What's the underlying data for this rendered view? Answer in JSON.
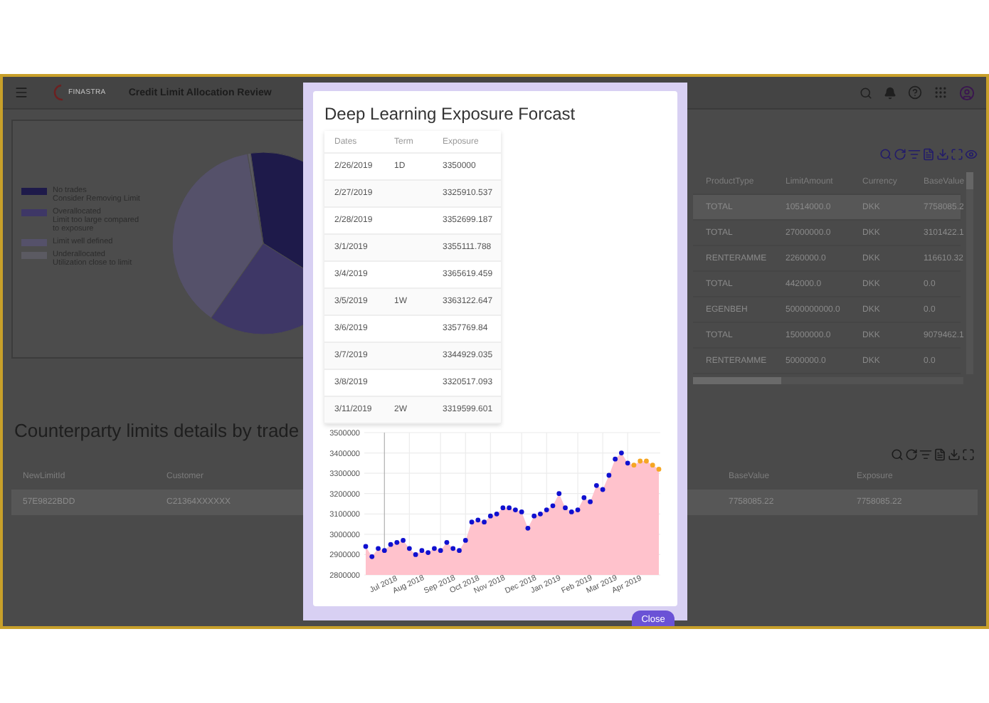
{
  "app_bar": {
    "logo_text": "FINASTRA",
    "title": "Credit Limit Allocation Review"
  },
  "allocation_chart": {
    "legend": [
      {
        "lines": [
          "No trades",
          "Consider Removing Limit"
        ],
        "color": "#1e1a4a"
      },
      {
        "lines": [
          "Overallocated",
          "Limit too large compared",
          "to exposure"
        ],
        "color": "#3e3766"
      },
      {
        "lines": [
          "Limit well defined"
        ],
        "color": "#55516a"
      },
      {
        "lines": [
          "Underallocated",
          "Utilization close to limit"
        ],
        "color": "#5b5a62"
      }
    ]
  },
  "limits_table": {
    "columns": [
      "ProductType",
      "LimitAmount",
      "Currency",
      "BaseValue"
    ],
    "rows": [
      {
        "cells": [
          "TOTAL",
          "10514000.0",
          "DKK",
          "7758085.2"
        ],
        "selected": true
      },
      {
        "cells": [
          "TOTAL",
          "27000000.0",
          "DKK",
          "3101422.1"
        ],
        "selected": false
      },
      {
        "cells": [
          "RENTERAMME",
          "2260000.0",
          "DKK",
          "116610.32"
        ],
        "selected": false
      },
      {
        "cells": [
          "TOTAL",
          "442000.0",
          "DKK",
          "0.0"
        ],
        "selected": false
      },
      {
        "cells": [
          "EGENBEH",
          "5000000000.0",
          "DKK",
          "0.0"
        ],
        "selected": false
      },
      {
        "cells": [
          "TOTAL",
          "15000000.0",
          "DKK",
          "9079462.1"
        ],
        "selected": false
      },
      {
        "cells": [
          "RENTERAMME",
          "5000000.0",
          "DKK",
          "0.0"
        ],
        "selected": false
      }
    ]
  },
  "trade_section": {
    "title": "Counterparty limits details by trade",
    "columns": [
      "NewLimitId",
      "Customer",
      "BaseValue",
      "Exposure"
    ],
    "rows": [
      {
        "cells": [
          "57E9822BDD",
          "C21364XXXXXX",
          "7758085.22",
          "7758085.22"
        ],
        "selected": true
      }
    ]
  },
  "dialog": {
    "title": "Deep Learning Exposure Forcast",
    "table": {
      "columns": [
        "Dates",
        "Term",
        "Exposure"
      ],
      "rows": [
        {
          "date": "2/26/2019",
          "term": "1D",
          "exposure": "3350000"
        },
        {
          "date": "2/27/2019",
          "exposure": "3325910.537"
        },
        {
          "date": "2/28/2019",
          "exposure": "3352699.187"
        },
        {
          "date": "3/1/2019",
          "exposure": "3355111.788"
        },
        {
          "date": "3/4/2019",
          "exposure": "3365619.459"
        },
        {
          "date": "3/5/2019",
          "term": "1W",
          "exposure": "3363122.647"
        },
        {
          "date": "3/6/2019",
          "exposure": "3357769.84"
        },
        {
          "date": "3/7/2019",
          "exposure": "3344929.035"
        },
        {
          "date": "3/8/2019",
          "exposure": "3320517.093"
        },
        {
          "date": "3/11/2019",
          "term": "2W",
          "exposure": "3319599.601"
        }
      ]
    },
    "markers": [
      {
        "color": "#1010d0"
      },
      {
        "color": "#1010d0"
      },
      {
        "color": "#1010d0"
      },
      {
        "color": "#1010d0"
      },
      {
        "color": "#1010d0"
      },
      {
        "color": "#1010d0"
      },
      {
        "color": "#1010d0"
      },
      {
        "color": "#1010d0"
      },
      {
        "color": "#1010d0"
      },
      {
        "color": "#1010d0"
      },
      {
        "color": "#1010d0"
      },
      {
        "color": "#1010d0"
      },
      {
        "color": "#1010d0"
      },
      {
        "color": "#1010d0"
      },
      {
        "color": "#1010d0"
      },
      {
        "color": "#1010d0"
      },
      {
        "color": "#1010d0"
      },
      {
        "color": "#1010d0"
      },
      {
        "color": "#1010d0"
      },
      {
        "color": "#1010d0"
      },
      {
        "color": "#1010d0"
      },
      {
        "color": "#1010d0"
      },
      {
        "color": "#1010d0"
      },
      {
        "color": "#1010d0"
      },
      {
        "color": "#1010d0"
      },
      {
        "color": "#1010d0"
      },
      {
        "color": "#1010d0"
      },
      {
        "color": "#1010d0"
      },
      {
        "color": "#1010d0"
      },
      {
        "color": "#1010d0"
      },
      {
        "color": "#1010d0"
      },
      {
        "color": "#1010d0"
      },
      {
        "color": "#1010d0"
      },
      {
        "color": "#1010d0"
      },
      {
        "color": "#1010d0"
      },
      {
        "color": "#1010d0"
      },
      {
        "color": "#1010d0"
      },
      {
        "color": "#1010d0"
      },
      {
        "color": "#1010d0"
      },
      {
        "color": "#1010d0"
      },
      {
        "color": "#1010d0"
      },
      {
        "color": "#1010d0"
      },
      {
        "color": "#1010d0"
      },
      {
        "color": "#f5a623"
      },
      {
        "color": "#f5a623"
      },
      {
        "color": "#f5a623"
      },
      {
        "color": "#f5a623"
      },
      {
        "color": "#f5a623"
      }
    ],
    "chart_data": {
      "type": "area",
      "grid": true,
      "categories": [
        null,
        null,
        null,
        "Jul 2018",
        null,
        null,
        null,
        "Aug 2018",
        null,
        null,
        null,
        null,
        "Sep 2018",
        null,
        null,
        null,
        "Oct 2018",
        null,
        null,
        null,
        "Nov 2018",
        null,
        null,
        null,
        null,
        "Dec 2018",
        null,
        null,
        null,
        "Jan 2019",
        null,
        null,
        null,
        null,
        "Feb 2019",
        null,
        null,
        null,
        "Mar 2019",
        null,
        null,
        null,
        "Apr 2019",
        null,
        null,
        null,
        null,
        null
      ],
      "series": [
        {
          "color": "#ffc2cc",
          "values": [
            2940000,
            2890000,
            2930000,
            2920000,
            2950000,
            2960000,
            2970000,
            2930000,
            2900000,
            2920000,
            2910000,
            2930000,
            2920000,
            2960000,
            2930000,
            2920000,
            2970000,
            3060000,
            3070000,
            3060000,
            3090000,
            3100000,
            3130000,
            3130000,
            3120000,
            3110000,
            3030000,
            3090000,
            3100000,
            3120000,
            3140000,
            3200000,
            3130000,
            3110000,
            3120000,
            3180000,
            3160000,
            3240000,
            3220000,
            3290000,
            3370000,
            3400000,
            3350000,
            3340000,
            3360000,
            3360000,
            3340000,
            3320000
          ]
        }
      ],
      "ylim": [
        2800000,
        3500000
      ],
      "yticks": [
        {
          "value": 2800000,
          "label": "2800000"
        },
        {
          "value": 2900000,
          "label": "2900000"
        },
        {
          "value": 3000000,
          "label": "3000000"
        },
        {
          "value": 3100000,
          "label": "3100000"
        },
        {
          "value": 3200000,
          "label": "3200000"
        },
        {
          "value": 3300000,
          "label": "3300000"
        },
        {
          "value": 3400000,
          "label": "3400000"
        },
        {
          "value": 3500000,
          "label": "3500000"
        }
      ]
    },
    "close_button": "Close"
  }
}
